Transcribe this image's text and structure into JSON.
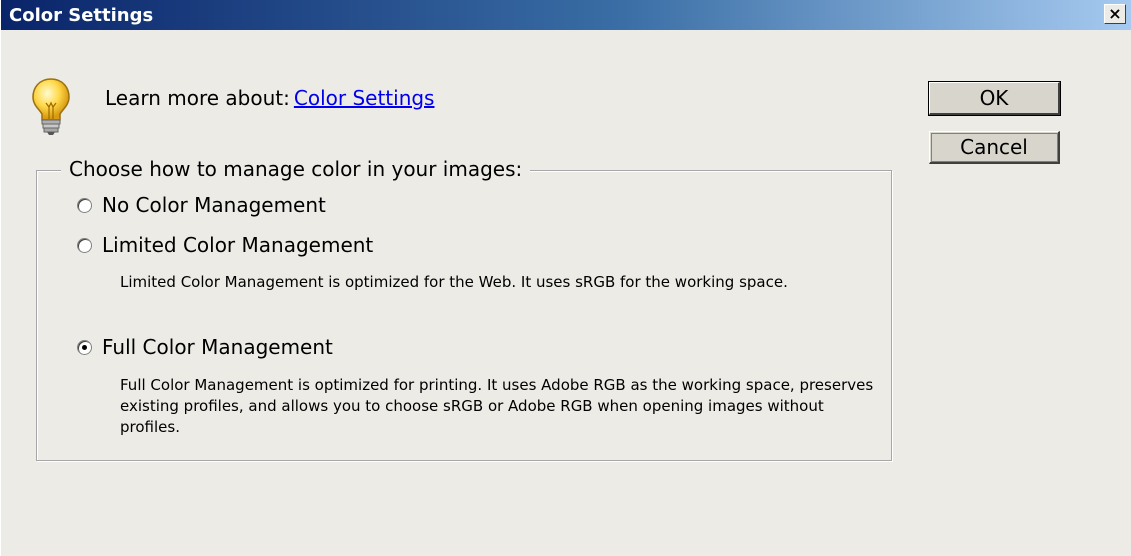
{
  "window": {
    "title": "Color Settings",
    "close_label": "×"
  },
  "tip": {
    "prefix": "Learn more about:",
    "link": "Color Settings"
  },
  "group": {
    "legend": "Choose how to manage color in your images:",
    "options": [
      {
        "label": "No Color Management",
        "checked": false
      },
      {
        "label": "Limited Color Management",
        "checked": false,
        "description": "Limited Color Management is optimized for the Web. It uses sRGB for the working space."
      },
      {
        "label": "Full Color Management",
        "checked": true,
        "description": "Full Color Management is optimized for printing. It uses Adobe RGB as the working space, preserves existing profiles, and allows you to choose sRGB or Adobe RGB when opening images without profiles."
      }
    ]
  },
  "buttons": {
    "ok": "OK",
    "cancel": "Cancel"
  }
}
